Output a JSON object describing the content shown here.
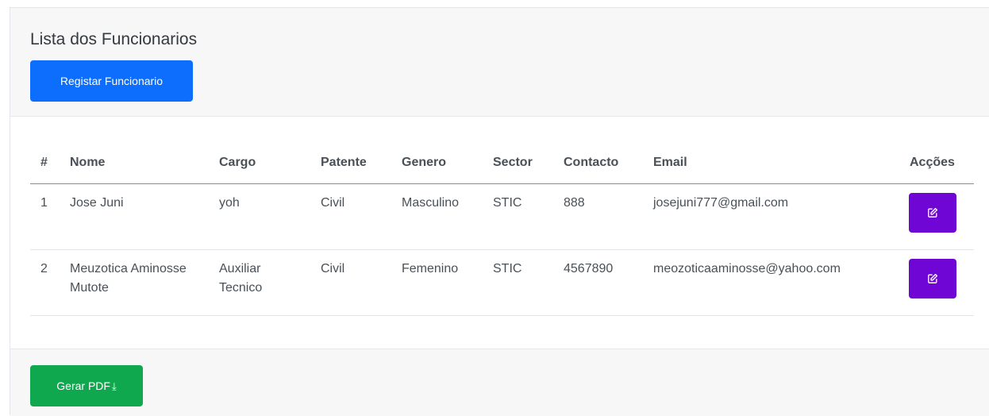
{
  "page": {
    "title": "Lista dos Funcionarios",
    "register_button": "Registar Funcionario",
    "pdf_button": "Gerar PDF",
    "pdf_icon": "download-icon"
  },
  "table": {
    "headers": [
      "#",
      "Nome",
      "Cargo",
      "Patente",
      "Genero",
      "Sector",
      "Contacto",
      "Email",
      "Acções"
    ],
    "rows": [
      {
        "id": "1",
        "nome": "Jose Juni",
        "cargo": "yoh",
        "patente": "Civil",
        "genero": "Masculino",
        "sector": "STIC",
        "contacto": "888",
        "email": "josejuni777@gmail.com",
        "action_icon": "edit-icon"
      },
      {
        "id": "2",
        "nome": "Meuzotica Aminosse Mutote",
        "cargo": "Auxiliar Tecnico",
        "patente": "Civil",
        "genero": "Femenino",
        "sector": "STIC",
        "contacto": "4567890",
        "email": "meozoticaaminosse@yahoo.com",
        "action_icon": "edit-icon"
      }
    ]
  },
  "colors": {
    "primary": "#0d6efd",
    "success": "#10a84f",
    "edit": "#6f06d6"
  }
}
